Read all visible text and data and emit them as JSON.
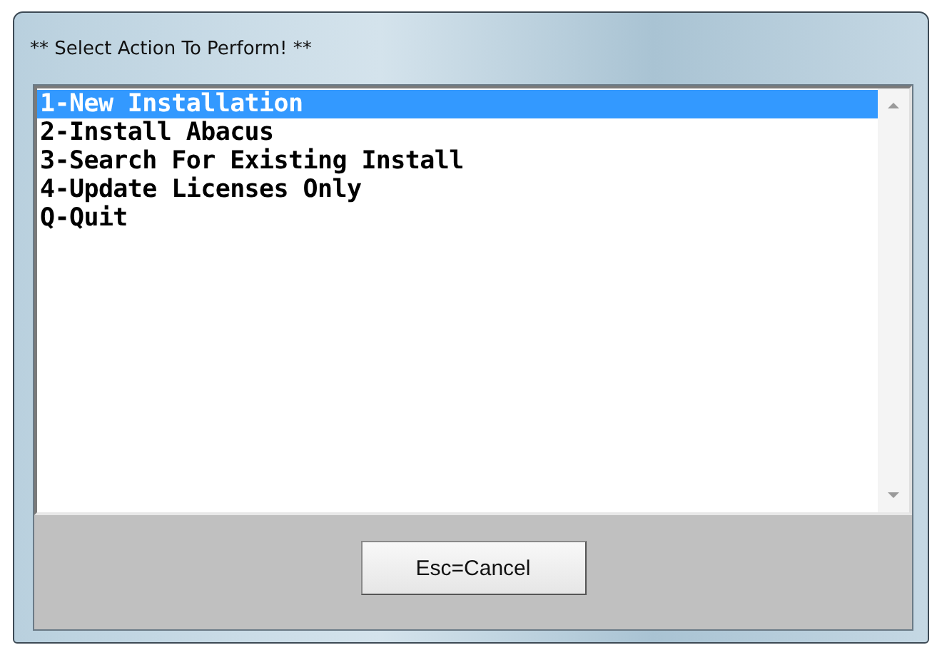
{
  "window": {
    "title": "** Select Action To Perform! **"
  },
  "list": {
    "items": [
      {
        "label": "1-New Installation",
        "selected": true
      },
      {
        "label": "2-Install Abacus",
        "selected": false
      },
      {
        "label": "3-Search For Existing Install",
        "selected": false
      },
      {
        "label": "4-Update Licenses Only",
        "selected": false
      },
      {
        "label": "Q-Quit",
        "selected": false
      }
    ]
  },
  "buttons": [
    "Esc=Cancel"
  ]
}
